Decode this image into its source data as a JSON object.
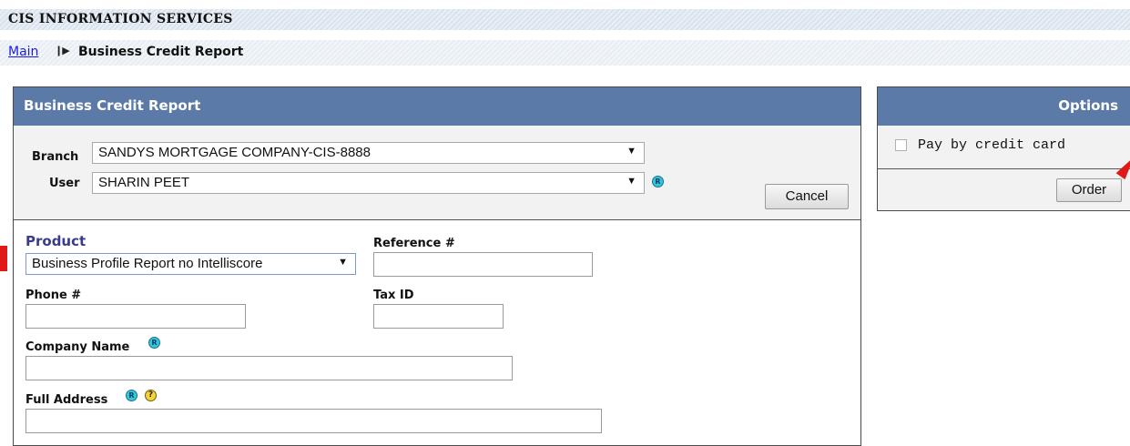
{
  "header": {
    "title": "CIS INFORMATION SERVICES"
  },
  "breadcrumb": {
    "main_link": "Main",
    "separator": "❙▶",
    "current": "Business Credit Report"
  },
  "main_panel": {
    "title": "Business Credit Report",
    "branch_label": "Branch",
    "branch_value": "SANDYS MORTGAGE COMPANY-CIS-8888",
    "user_label": "User",
    "user_value": "SHARIN PEET",
    "cancel_label": "Cancel",
    "product_label": "Product",
    "product_value": "Business Profile Report no Intelliscore",
    "reference_label": "Reference #",
    "reference_value": "",
    "phone_label": "Phone #",
    "phone_value": "",
    "taxid_label": "Tax ID",
    "taxid_value": "",
    "company_label": "Company Name",
    "company_value": "",
    "address_label": "Full Address",
    "address_value": ""
  },
  "options_panel": {
    "title": "Options",
    "pay_label": "Pay by credit card",
    "pay_checked": false,
    "order_label": "Order"
  },
  "icons": {
    "help": "help-circle-icon",
    "question": "question-icon",
    "dropdown": "chevron-down-icon"
  },
  "colors": {
    "header_blue": "#5b7aa7",
    "marker_red": "#e01818",
    "link_blue": "#1a1aee"
  }
}
